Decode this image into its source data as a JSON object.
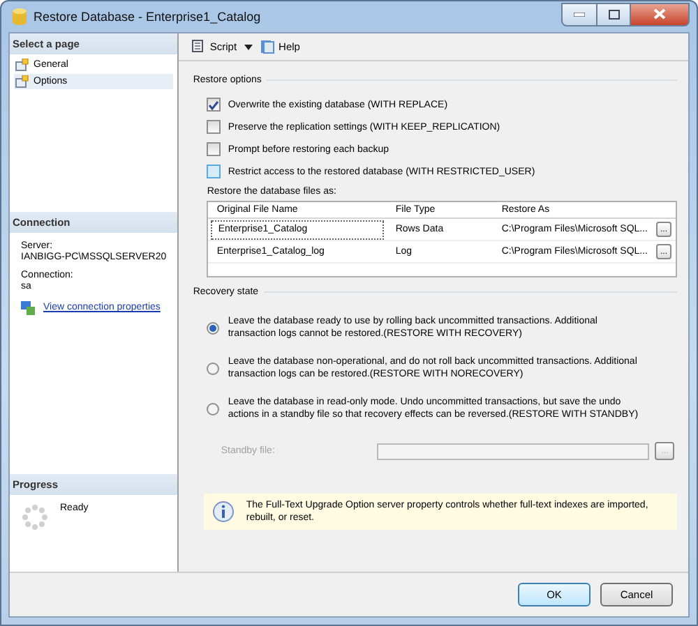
{
  "window": {
    "title": "Restore Database - Enterprise1_Catalog"
  },
  "sidebar": {
    "header": "Select a page",
    "pages": [
      {
        "label": "General",
        "selected": false
      },
      {
        "label": "Options",
        "selected": true
      }
    ]
  },
  "connection": {
    "header": "Connection",
    "server_label": "Server:",
    "server": "IANBIGG-PC\\MSSQLSERVER20",
    "connection_label": "Connection:",
    "connection": "sa",
    "link": "View connection properties"
  },
  "progress": {
    "header": "Progress",
    "status": "Ready"
  },
  "toolbar": {
    "script": "Script",
    "help": "Help"
  },
  "restore_options": {
    "title": "Restore options",
    "checkboxes": [
      {
        "label": "Overwrite the existing database (WITH REPLACE)",
        "checked": true,
        "hovered": false
      },
      {
        "label": "Preserve the replication settings (WITH KEEP_REPLICATION)",
        "checked": false,
        "hovered": false
      },
      {
        "label": "Prompt before restoring each backup",
        "checked": false,
        "hovered": false
      },
      {
        "label": "Restrict access to the restored database (WITH RESTRICTED_USER)",
        "checked": false,
        "hovered": true
      }
    ]
  },
  "files": {
    "label": "Restore the database files as:",
    "columns": [
      "Original File Name",
      "File Type",
      "Restore As"
    ],
    "rows": [
      {
        "original": "Enterprise1_Catalog",
        "type": "Rows Data",
        "restore_as": "C:\\Program Files\\Microsoft SQL...",
        "browse": "..."
      },
      {
        "original": "Enterprise1_Catalog_log",
        "type": "Log",
        "restore_as": "C:\\Program Files\\Microsoft SQL...",
        "browse": "..."
      }
    ]
  },
  "recovery": {
    "title": "Recovery state",
    "options": [
      {
        "label": "Leave the database ready to use by rolling back uncommitted transactions. Additional transaction logs cannot be restored.(RESTORE WITH RECOVERY)",
        "selected": true
      },
      {
        "label": "Leave the database non-operational, and do not roll back uncommitted transactions. Additional transaction logs can be restored.(RESTORE WITH NORECOVERY)",
        "selected": false
      },
      {
        "label": "Leave the database in read-only mode. Undo uncommitted transactions, but save the undo actions in a standby file so that recovery effects can be reversed.(RESTORE WITH STANDBY)",
        "selected": false
      }
    ],
    "standby_label": "Standby file:",
    "standby_disabled": true,
    "standby_browse": "..."
  },
  "info": "The Full-Text Upgrade Option server property controls whether full-text indexes are imported, rebuilt, or reset.",
  "buttons": [
    "OK",
    "Cancel"
  ]
}
